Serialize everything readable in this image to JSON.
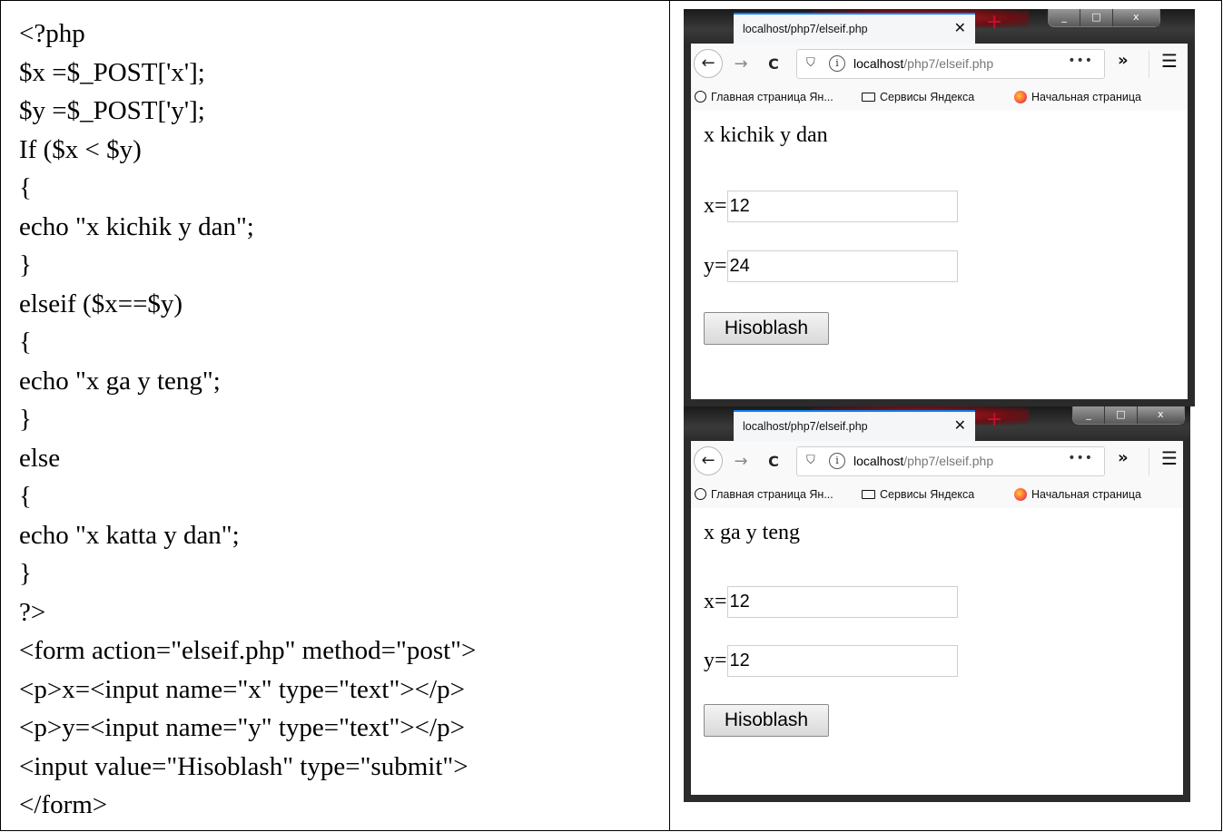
{
  "code": {
    "lines": [
      "<?php",
      "$x =$_POST['x'];",
      "$y =$_POST['y'];",
      "If ($x < $y)",
      "{",
      "echo \"x kichik y dan\";",
      "}",
      "elseif ($x==$y)",
      "{",
      "echo \"x ga y teng\";",
      "}",
      "else",
      "{",
      "echo \"x katta y dan\";",
      "}",
      "?>",
      "<form action=\"elseif.php\" method=\"post\">",
      "<p>x=<input name=\"x\" type=\"text\"></p>",
      "<p>y=<input name=\"y\" type=\"text\"></p>",
      "<input value=\"Hisoblash\" type=\"submit\">",
      "</form>"
    ]
  },
  "browsers": [
    {
      "tab_title": "localhost/php7/elseif.php",
      "tab_close": "✕",
      "new_tab": "+",
      "url_host": "localhost",
      "url_path": "/php7/elseif.php",
      "url_more": "•••",
      "overflow": "»",
      "menu": "☰",
      "bookmarks": [
        "Главная страница Ян...",
        "Сервисы Яндекса",
        "Начальная страница"
      ],
      "result": "x kichik y dan",
      "x_label": "x=",
      "x_value": "12",
      "y_label": "y=",
      "y_value": "24",
      "button": "Hisoblash"
    },
    {
      "tab_title": "localhost/php7/elseif.php",
      "tab_close": "✕",
      "new_tab": "+",
      "url_host": "localhost",
      "url_path": "/php7/elseif.php",
      "url_more": "•••",
      "overflow": "»",
      "menu": "☰",
      "bookmarks": [
        "Главная страница Ян...",
        "Сервисы Яндекса",
        "Начальная страница"
      ],
      "result": "x ga y teng",
      "x_label": "x=",
      "x_value": "12",
      "y_label": "y=",
      "y_value": "12",
      "button": "Hisoblash"
    }
  ],
  "icons": {
    "back": "←",
    "forward": "→",
    "reload": "C",
    "shield": "⛉",
    "info": "i",
    "win_min": "_",
    "win_max": "□",
    "win_close": "x"
  }
}
